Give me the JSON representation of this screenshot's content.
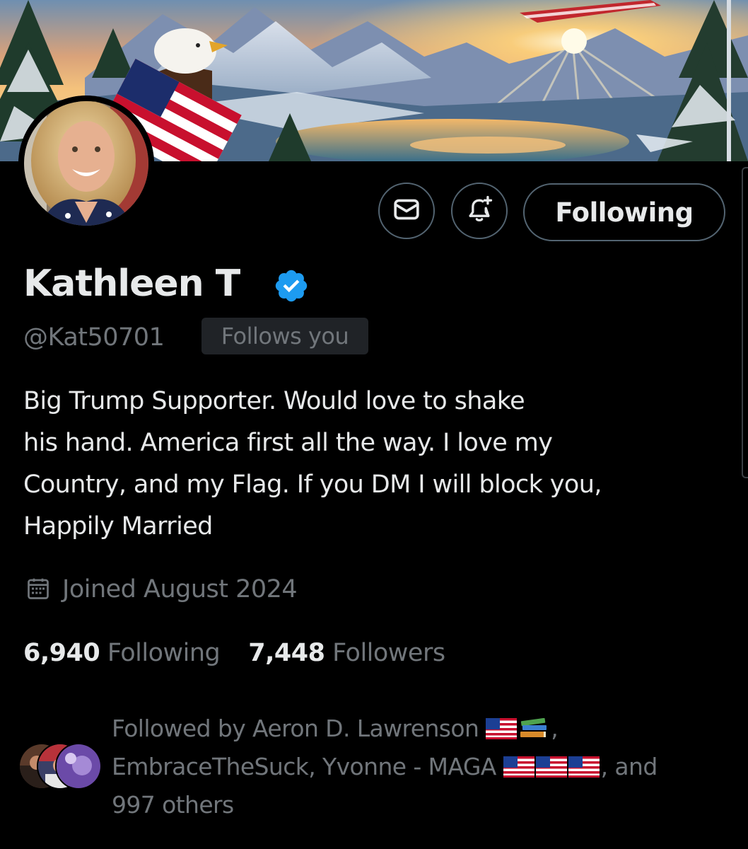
{
  "profile": {
    "display_name": "Kathleen T",
    "verified": true,
    "handle": "@Kat50701",
    "follows_you_badge": "Follows you",
    "bio_lines": [
      "Big Trump  Supporter. Would love to shake",
      "his hand. America first all the way. I love my",
      "Country, and my Flag. If you DM I will block you,",
      "Happily Married"
    ],
    "joined": "Joined August 2024"
  },
  "actions": {
    "message_icon": "envelope-icon",
    "notify_icon": "bell-plus-icon",
    "following_label": "Following"
  },
  "stats": {
    "following_count": "6,940",
    "following_label": "Following",
    "followers_count": "7,448",
    "followers_label": "Followers"
  },
  "followed_by": {
    "line1_text": "Followed by Aeron D. Lawrenson ",
    "line1_suffix": ",",
    "line2_text": "EmbraceTheSuck, Yvonne - MAGA ",
    "line2_suffix": ", and",
    "line3_text": "997 others",
    "line1_emojis": [
      "us-flag-emoji",
      "books-emoji"
    ],
    "line2_emojis": [
      "us-flag-emoji",
      "us-flag-emoji",
      "us-flag-emoji"
    ]
  },
  "colors": {
    "background": "#000000",
    "text_primary": "#e7e9ea",
    "text_secondary": "#71767b",
    "border": "#536471",
    "verified_blue": "#1d9bf0",
    "badge_bg": "#202327"
  }
}
